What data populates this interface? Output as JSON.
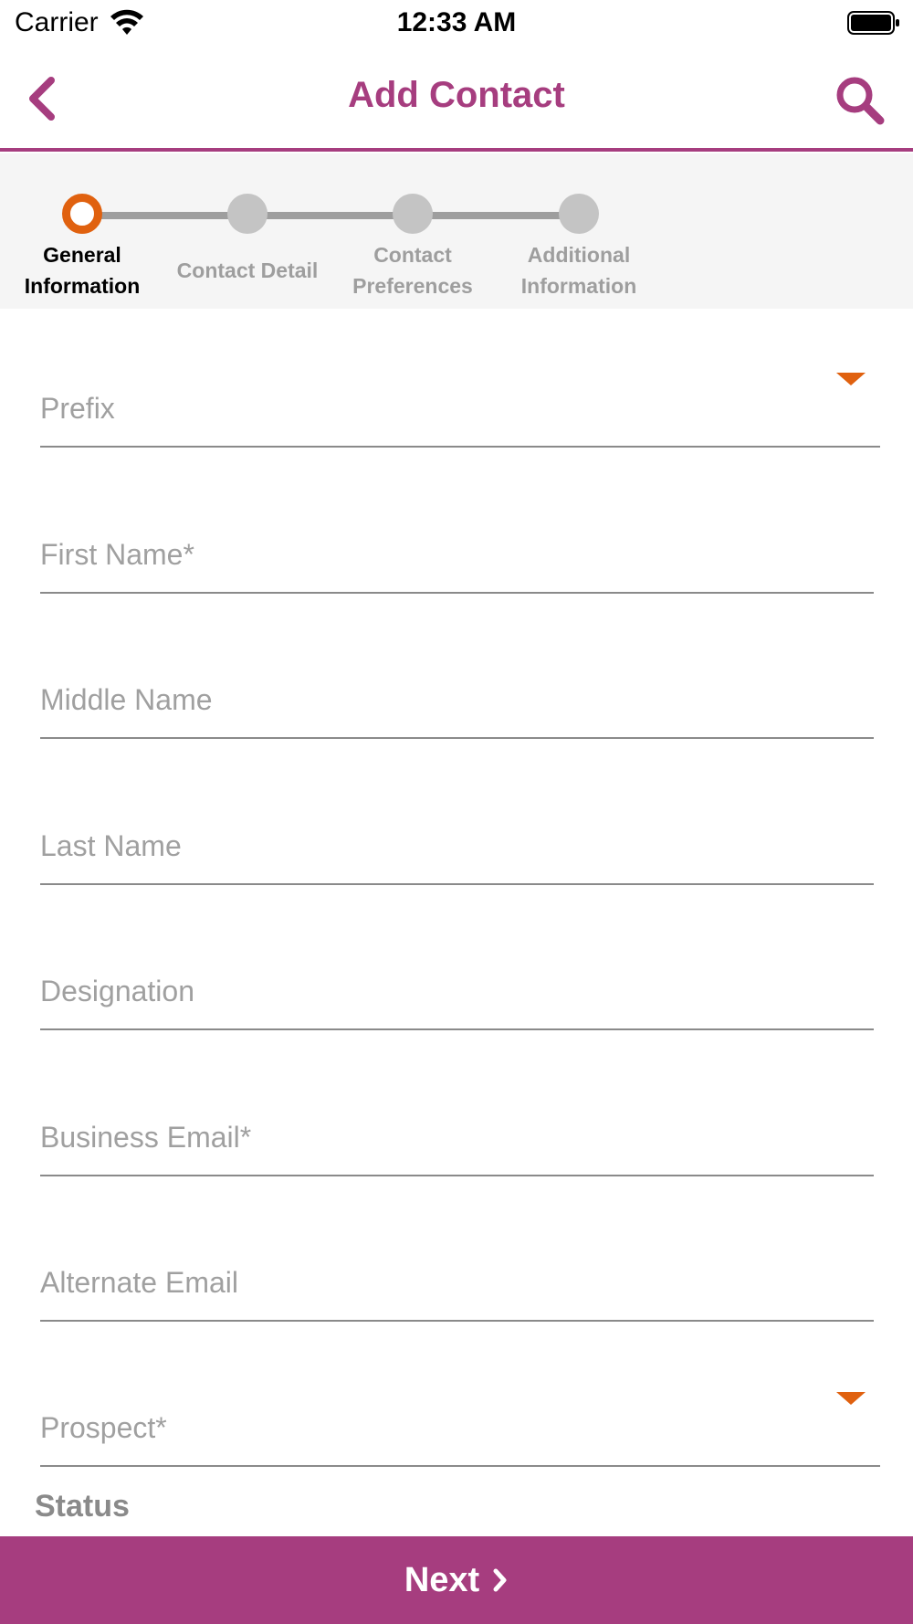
{
  "status_bar": {
    "carrier": "Carrier",
    "time": "12:33 AM"
  },
  "nav": {
    "title": "Add Contact",
    "back_icon": "chevron-left-icon",
    "search_icon": "search-icon"
  },
  "stepper": {
    "steps": [
      {
        "label": "General Information",
        "active": true
      },
      {
        "label": "Contact Detail",
        "active": false
      },
      {
        "label": "Contact Preferences",
        "active": false
      },
      {
        "label": "Additional Information",
        "active": false
      }
    ]
  },
  "form": {
    "fields": [
      {
        "placeholder": "Prefix",
        "value": "",
        "type": "dropdown"
      },
      {
        "placeholder": "First Name*",
        "value": "",
        "type": "text"
      },
      {
        "placeholder": "Middle Name",
        "value": "",
        "type": "text"
      },
      {
        "placeholder": "Last Name",
        "value": "",
        "type": "text"
      },
      {
        "placeholder": "Designation",
        "value": "",
        "type": "text"
      },
      {
        "placeholder": "Business Email*",
        "value": "",
        "type": "text"
      },
      {
        "placeholder": "Alternate Email",
        "value": "",
        "type": "text"
      },
      {
        "placeholder": "Prospect*",
        "value": "",
        "type": "dropdown"
      }
    ],
    "status_label": "Status"
  },
  "footer": {
    "next_label": "Next",
    "next_icon": "chevron-right-icon"
  },
  "colors": {
    "brand": "#a63d7f",
    "accent": "#e0610f",
    "inactive": "#c4c4c4"
  }
}
